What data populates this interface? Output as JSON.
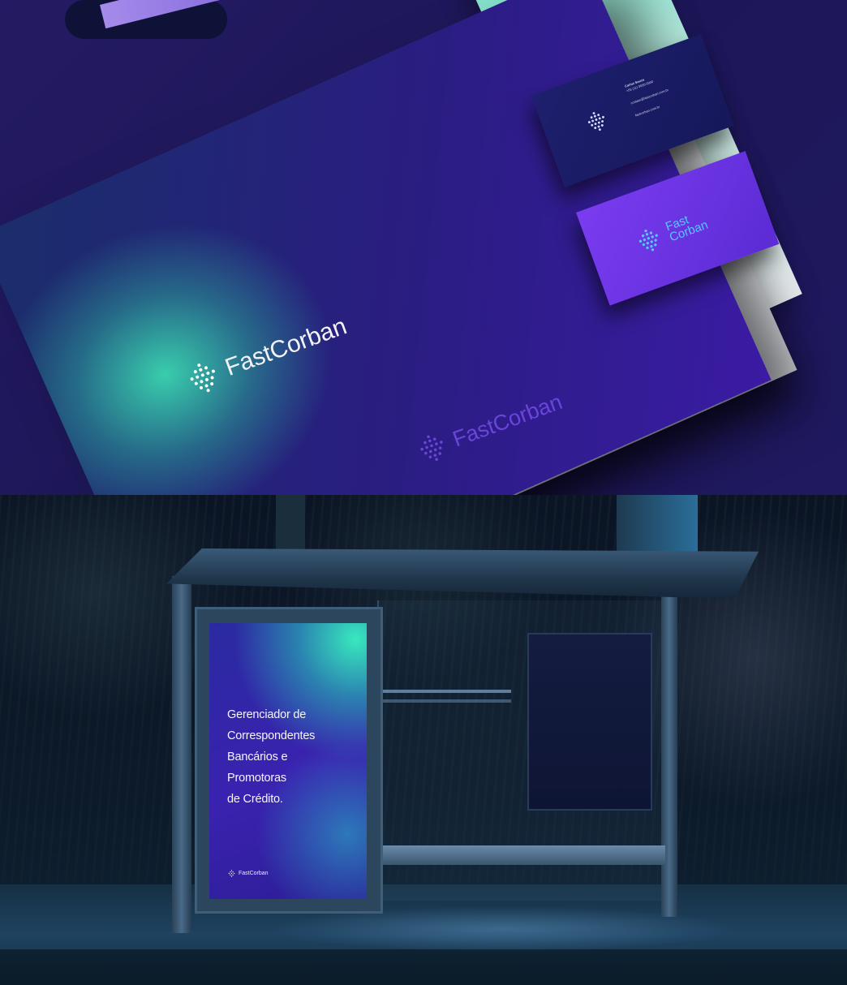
{
  "stationery": {
    "folder_logo": "FastCorban",
    "paper_logo": "FastCorban",
    "card_front_lines": [
      "Carlos Souza",
      "+55 (11) 0000-0000",
      "contato@fastcorban.com.br",
      "fastcorban.com.br"
    ],
    "card_back_logo_line1": "Fast",
    "card_back_logo_line2": "Corban"
  },
  "bus_stop": {
    "poster_lines": [
      "Gerenciador de",
      "Correspondentes",
      "Bancários e",
      "Promotoras",
      "de Crédito."
    ],
    "poster_logo": "FastCorban"
  },
  "colors": {
    "brand_purple": "#5b2bd4",
    "brand_mint": "#38e8be",
    "brand_navy": "#1d1758"
  },
  "icons": {
    "brand_mark": "dot-grid-diamond-icon"
  }
}
